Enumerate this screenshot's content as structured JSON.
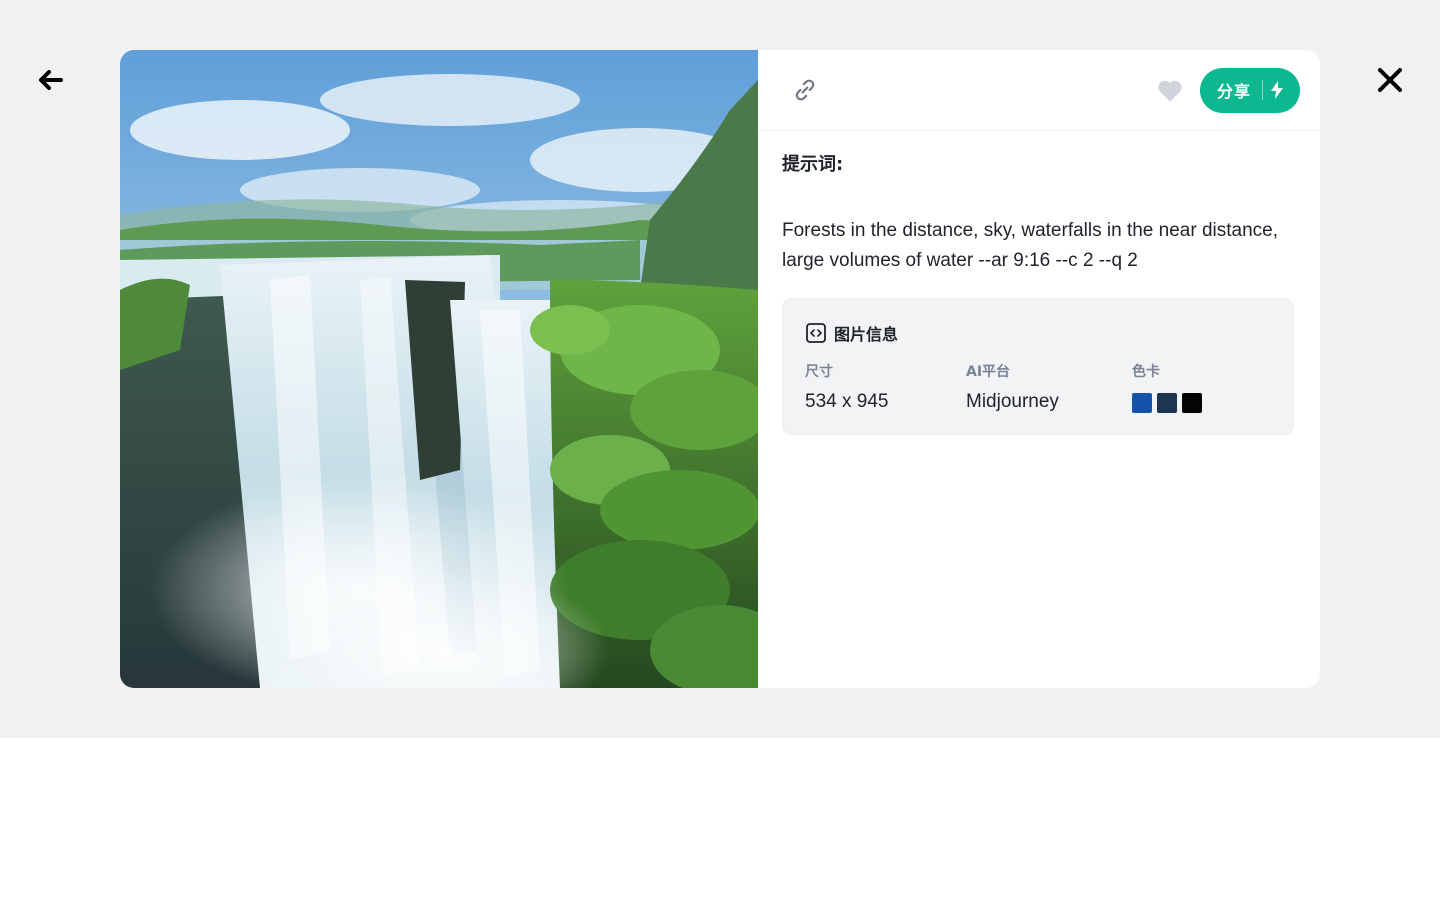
{
  "nav": {
    "back_icon": "arrow-left-icon",
    "close_icon": "close-x-icon"
  },
  "toolbar": {
    "link_icon": "link-icon",
    "like_icon": "heart-icon",
    "share_label": "分享",
    "share_icon": "lightning-bolt-icon",
    "share_color": "#0bb88f"
  },
  "prompt": {
    "title": "提示词:",
    "text": "Forests in the distance, sky, waterfalls in the near distance, large volumes of water --ar 9:16 --c 2 --q 2"
  },
  "image_info": {
    "title": "图片信息",
    "icon": "code-bracket-icon",
    "size_label": "尺寸",
    "size_value": "534 x 945",
    "platform_label": "AI平台",
    "platform_value": "Midjourney",
    "palette_label": "色卡",
    "palette": [
      "#1352a8",
      "#1d3550",
      "#020405"
    ]
  }
}
